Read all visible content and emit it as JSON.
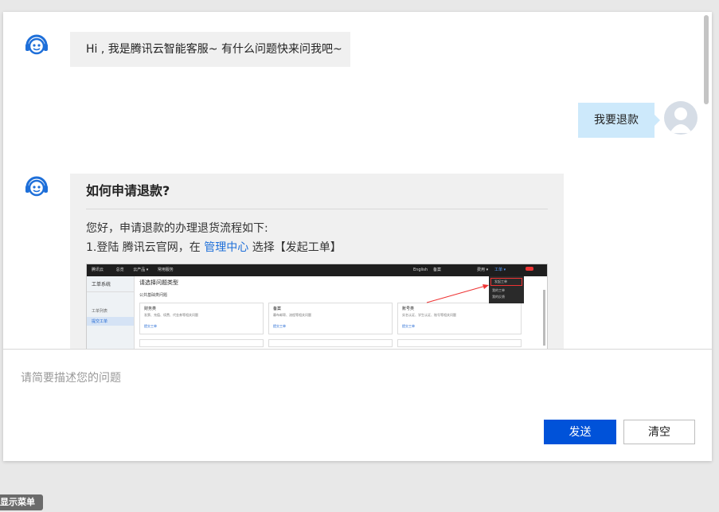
{
  "chat": {
    "greeting": "Hi , 我是腾讯云智能客服~ 有什么问题快来问我吧~",
    "user_message": "我要退款",
    "answer": {
      "title": "如何申请退款?",
      "line1": "您好，申请退款的办理退货流程如下:",
      "line2_prefix": "1.登陆 腾讯云官网，在 ",
      "line2_link": "管理中心",
      "line2_suffix": " 选择【发起工单】"
    }
  },
  "screenshot": {
    "brand": "腾讯云",
    "nav": [
      "总览",
      "云产品 ▾",
      "常用服务"
    ],
    "right_nav": [
      "English",
      "备案",
      "费用 ▾",
      "工单 ▾"
    ],
    "sidebar_title": "工单系统",
    "sidebar_items": [
      "工单列表",
      "提交工单"
    ],
    "page_title": "请选择问题类型",
    "section_title": "公共基础类问题",
    "cards": [
      {
        "title": "财务类",
        "desc": "发票、充值、续费、代金券等相关问题",
        "link": "提交工单"
      },
      {
        "title": "备案",
        "desc": "幕布邮寄、流程等相关问题",
        "link": "提交工单"
      },
      {
        "title": "账号类",
        "desc": "实名认证、学生认证、账号等相关问题",
        "link": "提交工单"
      }
    ],
    "dropdown": [
      "发起工单",
      "我的工单",
      "我的反馈"
    ]
  },
  "input": {
    "placeholder": "请简要描述您的问题"
  },
  "buttons": {
    "send": "发送",
    "clear": "清空"
  },
  "menu_toggle": "显示菜单",
  "colors": {
    "primary": "#0052d9",
    "user_bubble": "#cde9fb",
    "bot_icon": "#1e6fd9"
  }
}
